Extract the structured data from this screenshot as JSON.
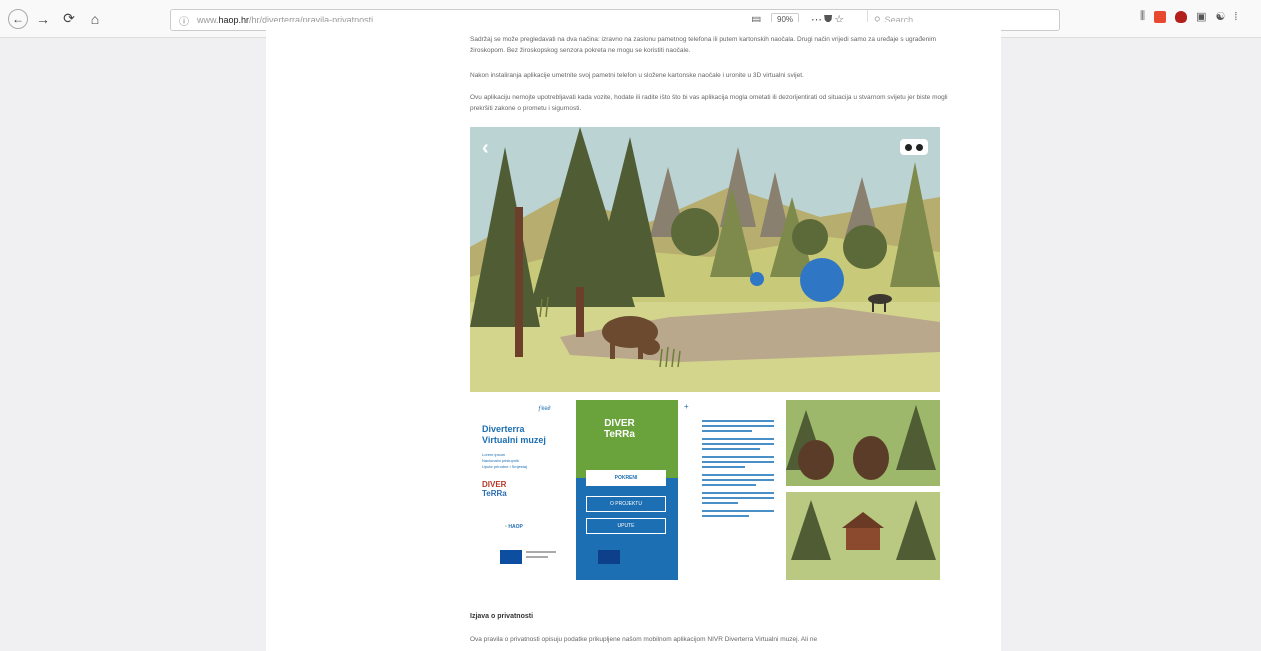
{
  "browser": {
    "url_prefix": "www.",
    "url_domain": "haop.hr",
    "url_path": "/hr/diverterra/pravila-privatnosti",
    "zoom": "90%",
    "search_placeholder": "Search"
  },
  "article": {
    "paragraph_1": "Sadržaj se može pregledavati na dva načina: izravno na zaslonu pametnog telefona ili putem kartonskih naočala. Drugi način vrijedi samo za uređaje s ugrađenim žiroskopom. Bez žiroskopskog senzora pokreta ne mogu se koristiti naočale.",
    "paragraph_2": "Nakon instaliranja aplikacije umetnite svoj pametni telefon u složene kartonske naočale i uronite u 3D virtualni svijet.",
    "paragraph_3": "Ovu aplikaciju nemojte upotrebljavati kada vozite, hodate ili radite išto što bi vas aplikacija mogla ometati ili dezorijentirati od situacija u stvarnom svijetu jer biste mogli prekršiti zakone o prometu i sigurnosti.",
    "section_heading": "Izjava o privatnosti",
    "paragraph_4": "Ova pravila o privatnosti opisuju podatke prikupljene našom mobilnom aplikacijom NIVR Diverterra Virtualni muzej. Ali ne"
  },
  "mockups": {
    "card1_title_line1": "Diverterra",
    "card1_title_line2": "Virtualni muzej",
    "card1_lines": [
      "Lorem ipsum",
      "Nacionalni pristupnik",
      "Upute prirodne i Smjestaj"
    ],
    "card1_haop": "HAOP",
    "card2_logo_line1": "DIVER",
    "card2_logo_line2": "TeRRa",
    "card2_btn_start": "POKRENI",
    "card2_btn_about": "O PROJEKTU",
    "card2_btn_help": "UPUTE",
    "logo_line1": "DIVER",
    "logo_line2": "TeRRa"
  },
  "colors": {
    "accent_blue": "#1d6fb3",
    "green_card": "#6aa33c",
    "page_bg": "#f0f0f2",
    "scene_sky": "#bcd3d4"
  },
  "icons": [
    "back-icon",
    "forward-icon",
    "reload-icon",
    "home-icon",
    "info-icon",
    "reader-icon",
    "pocket-icon",
    "star-icon",
    "library-icon",
    "vr-cardboard-icon",
    "chevron-left-icon",
    "plus-icon"
  ]
}
